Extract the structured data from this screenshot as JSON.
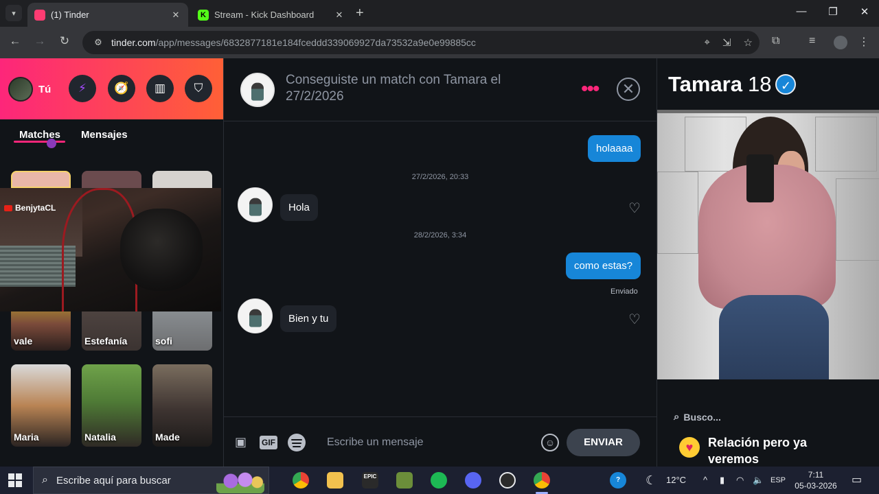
{
  "browser": {
    "tabs": [
      {
        "title": "(1) Tinder",
        "active": true
      },
      {
        "title": "Stream - Kick Dashboard",
        "active": false
      }
    ],
    "url_host": "tinder.com",
    "url_path": "/app/messages/6832877181e184fceddd339069927da73532a9e0e99885cc"
  },
  "sidebar": {
    "profile_label": "Tú",
    "tabs": {
      "matches": "Matches",
      "messages": "Mensajes"
    },
    "matches_row2": [
      "vale",
      "Estefanía",
      "sofi"
    ],
    "matches_row3": [
      "Maria",
      "Natalia",
      "Made"
    ]
  },
  "webcam": {
    "channel": "BenjytaCL"
  },
  "chat": {
    "header_title": "Conseguiste un match con Tamara el 27/2/2026",
    "messages": {
      "m1": "holaaaa",
      "ts1": "27/2/2026, 20:33",
      "m2": "Hola",
      "ts2": "28/2/2026, 3:34",
      "m3": "como estas?",
      "status": "Enviado",
      "m4": "Bien y tu"
    },
    "compose_placeholder": "Escribe un mensaje",
    "gif_label": "GIF",
    "send_label": "ENVIAR"
  },
  "profile": {
    "name": "Tamara",
    "age": "18",
    "looking_for_label": "Busco...",
    "looking_for_value": "Relación pero ya veremos"
  },
  "taskbar": {
    "search_placeholder": "Escribe aquí para buscar",
    "temperature": "12°C",
    "language": "ESP",
    "time": "7:11",
    "date": "05-03-2026",
    "epic_label": "EPIC"
  },
  "colors": {
    "tinder_gradient_start": "#fd267a",
    "tinder_gradient_end": "#ff6036",
    "outgoing_bubble": "#1786d8"
  },
  "icons": [
    "lightning-icon",
    "compass-icon",
    "briefcase-icon",
    "shield-icon",
    "heart-icon",
    "close-icon",
    "verified-icon",
    "search-icon",
    "emoji-icon",
    "contact-icon",
    "spotify-icon"
  ]
}
